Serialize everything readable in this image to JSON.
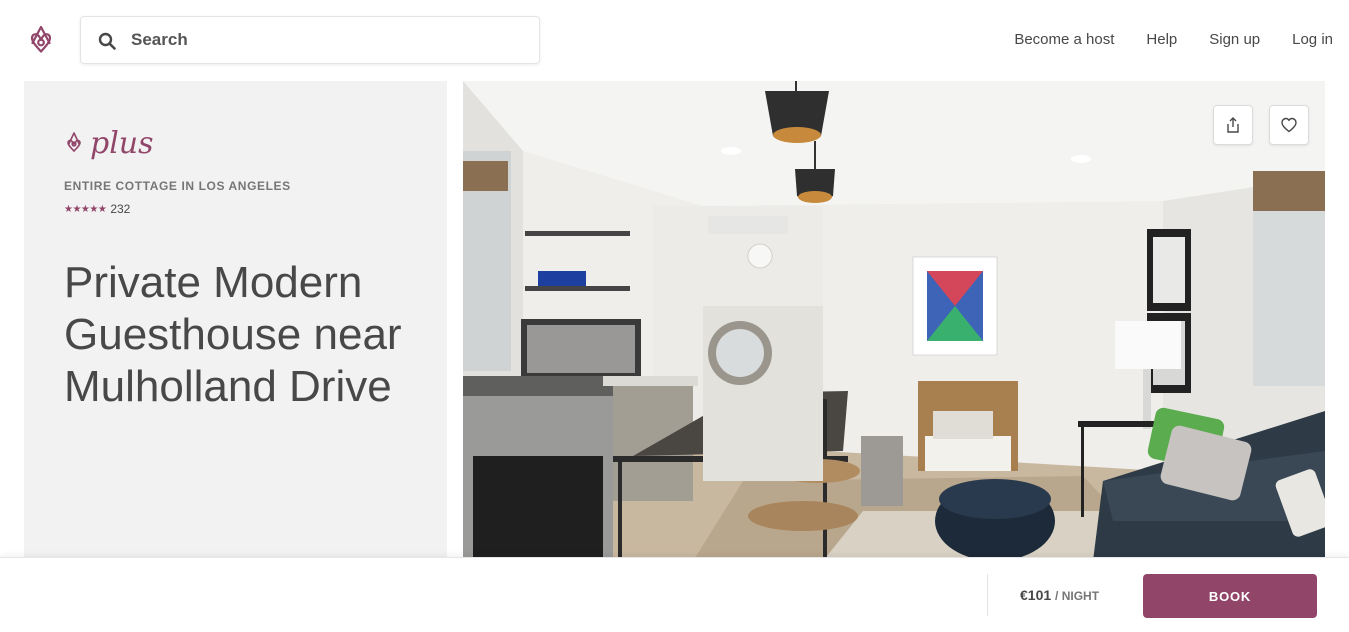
{
  "header": {
    "logo": "airbnb-logo",
    "search": {
      "placeholder": "Search",
      "value": ""
    },
    "nav": [
      {
        "label": "Become a host"
      },
      {
        "label": "Help"
      },
      {
        "label": "Sign up"
      },
      {
        "label": "Log in"
      }
    ]
  },
  "listing": {
    "badge": "plus",
    "kicker": "ENTIRE COTTAGE IN LOS ANGELES",
    "stars": "★★★★★",
    "review_count": "232",
    "title": "Private Modern Guesthouse near Mulholland Drive"
  },
  "photo": {
    "share_icon": "share-icon",
    "save_icon": "heart-icon"
  },
  "booking": {
    "price": "€101",
    "unit": "/ NIGHT",
    "button_label": "BOOK"
  },
  "colors": {
    "accent": "#914669",
    "text": "#484848",
    "panel": "#f2f2f2"
  }
}
